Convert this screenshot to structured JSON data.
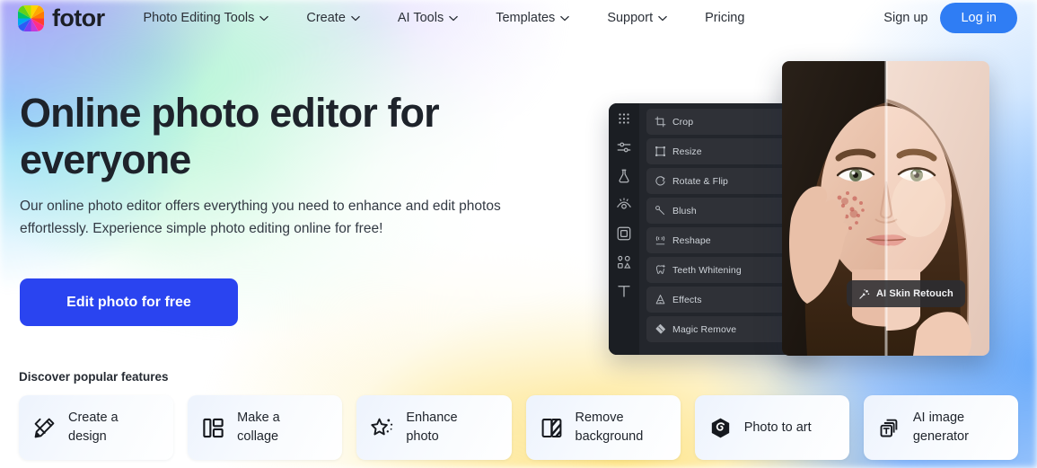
{
  "brand": {
    "name": "fotor",
    "icon": "color-wheel-logo-icon"
  },
  "nav": {
    "items": [
      {
        "label": "Photo Editing Tools",
        "has_caret": true
      },
      {
        "label": "Create",
        "has_caret": true
      },
      {
        "label": "AI Tools",
        "has_caret": true
      },
      {
        "label": "Templates",
        "has_caret": true
      },
      {
        "label": "Support",
        "has_caret": true
      },
      {
        "label": "Pricing",
        "has_caret": false
      }
    ],
    "signup_label": "Sign up",
    "login_label": "Log in",
    "login_color": "#2f7df4"
  },
  "hero": {
    "title": "Online photo editor for everyone",
    "subtitle": "Our online photo editor offers everything you need to enhance and edit photos effortlessly. Experience simple photo editing online for free!",
    "cta_label": "Edit photo for free",
    "cta_color": "#2a44f0"
  },
  "editor": {
    "rail_icons": [
      "grid-dots-icon",
      "sliders-icon",
      "flask-icon",
      "eye-icon",
      "frame-icon",
      "shapes-icon",
      "text-t-icon"
    ],
    "tools": [
      {
        "label": "Crop",
        "icon": "crop-icon"
      },
      {
        "label": "Resize",
        "icon": "resize-icon"
      },
      {
        "label": "Rotate & Flip",
        "icon": "rotate-icon"
      },
      {
        "label": "Blush",
        "icon": "blush-icon"
      },
      {
        "label": "Reshape",
        "icon": "reshape-icon"
      },
      {
        "label": "Teeth Whitening",
        "icon": "tooth-icon"
      },
      {
        "label": "Effects",
        "icon": "effects-icon"
      },
      {
        "label": "Magic Remove",
        "icon": "eraser-icon"
      }
    ],
    "tooltip": {
      "label": "AI Skin Retouch",
      "icon": "ai-sparkle-brush-icon"
    }
  },
  "features": {
    "title": "Discover popular features",
    "cards": [
      {
        "label": "Create a\ndesign",
        "icon": "pencil-ruler-icon"
      },
      {
        "label": "Make a\ncollage",
        "icon": "collage-grid-icon"
      },
      {
        "label": "Enhance\nphoto",
        "icon": "magic-wand-sparkle-icon"
      },
      {
        "label": "Remove\nbackground",
        "icon": "background-remove-icon"
      },
      {
        "label": "Photo to art",
        "icon": "hexagon-swirl-icon"
      },
      {
        "label": "AI image\ngenerator",
        "icon": "ai-image-stack-icon"
      }
    ]
  }
}
